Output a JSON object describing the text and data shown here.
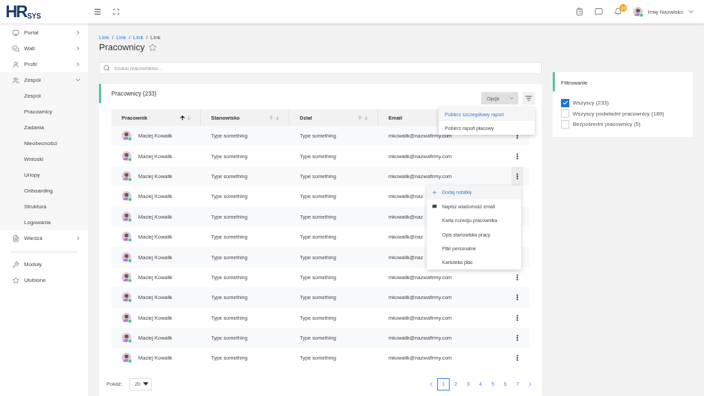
{
  "header": {
    "logo": {
      "mark": "HR",
      "text": "SYS"
    },
    "notifications_badge": "10",
    "user_name": "Imię Nazwisko"
  },
  "sidebar": {
    "main_items": [
      {
        "label": "Portal",
        "expanded": false
      },
      {
        "label": "Wall",
        "expanded": false
      },
      {
        "label": "Profil",
        "expanded": false
      },
      {
        "label": "Zespół",
        "expanded": true,
        "children": [
          {
            "label": "Zespół"
          },
          {
            "label": "Pracownicy"
          },
          {
            "label": "Zadania"
          },
          {
            "label": "Nieobecności"
          },
          {
            "label": "Wnioski"
          },
          {
            "label": "Urlopy"
          },
          {
            "label": "Onboarding"
          },
          {
            "label": "Struktura"
          },
          {
            "label": "Logowania"
          }
        ]
      },
      {
        "label": "Wiedza",
        "expanded": false
      }
    ],
    "bottom_items": [
      {
        "label": "Moduły"
      },
      {
        "label": "Ulubione"
      }
    ]
  },
  "breadcrumbs": [
    {
      "label": "Link",
      "link": true
    },
    {
      "separator": "/",
      "label": "Link",
      "link": true
    },
    {
      "separator": "/",
      "label": "Link",
      "link": true
    },
    {
      "separator": "/",
      "label": "Link",
      "link": false
    }
  ],
  "page_title": "Pracownicy",
  "favorite": false,
  "search": {
    "placeholder": "Szukaj pracowników..."
  },
  "card": {
    "title": "Pracownicy (233)",
    "options_button": "Opcje",
    "options_menu": {
      "open": true,
      "items": [
        {
          "label": "Pobierz szczegółowy raport",
          "selected": true
        },
        {
          "label": "Pobierz raport płacowy",
          "selected": false
        }
      ]
    }
  },
  "table": {
    "columns": [
      {
        "label": "Pracownik",
        "sorted_ascending": true
      },
      {
        "label": "Stanowisko",
        "sorted_ascending": false
      },
      {
        "label": "Dział",
        "sorted_ascending": false
      },
      {
        "label": "Email"
      }
    ],
    "rows": [
      {
        "name": "Maciej Kowalik",
        "position": "Type something",
        "department": "Type something",
        "email": "mkowalik@nazwafirmy.com",
        "menu_open": false,
        "actions_covered": false
      },
      {
        "name": "Maciej Kowalik",
        "position": "Type something",
        "department": "Type something",
        "email": "mkowalik@nazwafirmy.com",
        "menu_open": false,
        "actions_covered": false
      },
      {
        "name": "Maciej Kowalik",
        "position": "Type something",
        "department": "Type something",
        "email": "mkowalik@nazwafirmy.com",
        "menu_open": true,
        "actions_covered": false
      },
      {
        "name": "Maciej Kowalik",
        "position": "Type something",
        "department": "Type something",
        "email": "mkowalik@naz",
        "menu_open": false,
        "actions_covered": true
      },
      {
        "name": "Maciej Kowalik",
        "position": "Type something",
        "department": "Type something",
        "email": "mkowalik@naz",
        "menu_open": false,
        "actions_covered": true
      },
      {
        "name": "Maciej Kowalik",
        "position": "Type something",
        "department": "Type something",
        "email": "mkowalik@naz",
        "menu_open": false,
        "actions_covered": true
      },
      {
        "name": "Maciej Kowalik",
        "position": "Type something",
        "department": "Type something",
        "email": "mkowalik@naz",
        "menu_open": false,
        "actions_covered": true
      },
      {
        "name": "Maciej Kowalik",
        "position": "Type something",
        "department": "Type something",
        "email": "mkowalik@nazwafirmy.com",
        "menu_open": false,
        "actions_covered": false
      },
      {
        "name": "Maciej Kowalik",
        "position": "Type something",
        "department": "Type something",
        "email": "mkowalik@nazwafirmy.com",
        "menu_open": false,
        "actions_covered": false
      },
      {
        "name": "Maciej Kowalik",
        "position": "Type something",
        "department": "Type something",
        "email": "mkowalik@nazwafirmy.com",
        "menu_open": false,
        "actions_covered": false
      },
      {
        "name": "Maciej Kowalik",
        "position": "Type something",
        "department": "Type something",
        "email": "mkowalik@nazwafirmy.com",
        "menu_open": false,
        "actions_covered": false
      },
      {
        "name": "Maciej Kowalik",
        "position": "Type something",
        "department": "Type something",
        "email": "mkowalik@nazwafirmy.com",
        "menu_open": false,
        "actions_covered": false
      }
    ],
    "row_menu": [
      {
        "label": "Dodaj notatkę",
        "kind": "add",
        "selected": true
      },
      {
        "label": "Napisz wiadomość email",
        "kind": "email",
        "selected": false
      },
      {
        "label": "Karta rozwoju pracownika",
        "kind": "plain",
        "selected": false
      },
      {
        "label": "Opis stanowiska pracy",
        "kind": "plain",
        "selected": false
      },
      {
        "label": "Pliki personalne",
        "kind": "plain",
        "selected": false
      },
      {
        "label": "Kartoteka płac",
        "kind": "plain",
        "selected": false
      }
    ]
  },
  "pagination": {
    "show_label": "Pokaż:",
    "page_size": "20",
    "pages": [
      {
        "label": "1",
        "selected": true
      },
      {
        "label": "2",
        "selected": false
      },
      {
        "label": "3",
        "selected": false
      },
      {
        "label": "4",
        "selected": false
      },
      {
        "label": "5",
        "selected": false
      },
      {
        "label": "6",
        "selected": false
      },
      {
        "label": "7",
        "selected": false
      }
    ]
  },
  "filter": {
    "title": "Filtrowanie",
    "options": [
      {
        "label": "Wszyscy (233)",
        "checked": true
      },
      {
        "label": "Wszyscy podwładni pracownicy (189)",
        "checked": false
      },
      {
        "label": "Bezpośredni pracownicy (5)",
        "checked": false
      }
    ]
  }
}
